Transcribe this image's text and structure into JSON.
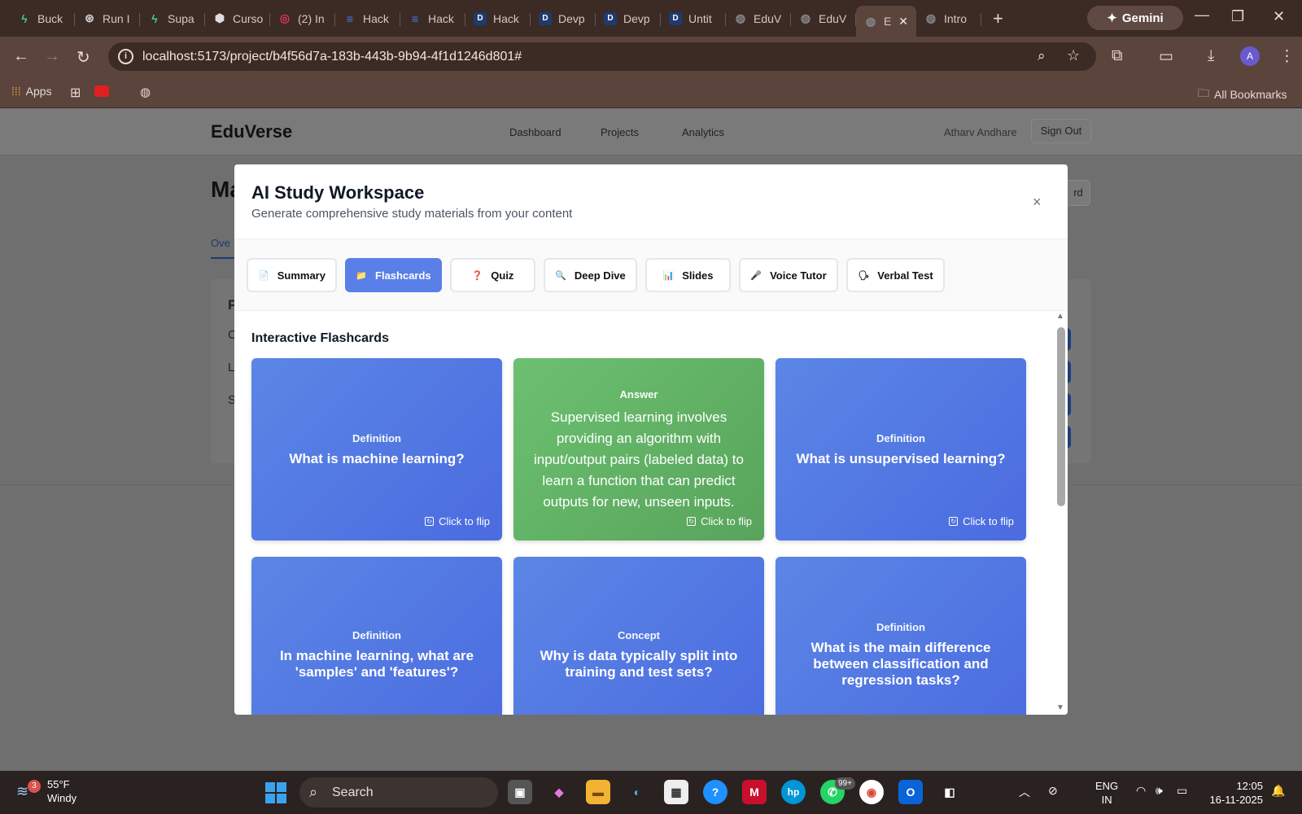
{
  "browser": {
    "tabs": [
      {
        "label": "Buck",
        "icon": "bolt",
        "color": "#3ecf8e"
      },
      {
        "label": "Run I",
        "icon": "openai",
        "color": "#cccccc"
      },
      {
        "label": "Supa",
        "icon": "bolt",
        "color": "#3ecf8e"
      },
      {
        "label": "Curso",
        "icon": "cube",
        "color": "#dddddd"
      },
      {
        "label": "(2) In",
        "icon": "instagram",
        "color": "#e1306c"
      },
      {
        "label": "Hack",
        "icon": "docs",
        "color": "#4a7df0"
      },
      {
        "label": "Hack",
        "icon": "docs",
        "color": "#4a7df0"
      },
      {
        "label": "Hack",
        "icon": "D",
        "color": "#1e3a6e"
      },
      {
        "label": "Devp",
        "icon": "D",
        "color": "#1e3a6e"
      },
      {
        "label": "Devp",
        "icon": "D",
        "color": "#1e3a6e"
      },
      {
        "label": "Untit",
        "icon": "D",
        "color": "#1e3a6e"
      },
      {
        "label": "EduV",
        "icon": "globe",
        "color": "#888888"
      },
      {
        "label": "EduV",
        "icon": "globe",
        "color": "#888888"
      },
      {
        "label": "E",
        "icon": "globe",
        "color": "#888888",
        "active": true
      },
      {
        "label": "Intro",
        "icon": "globe",
        "color": "#888888"
      }
    ],
    "new_tab": "+",
    "gemini_label": "Gemini",
    "url": "localhost:5173/project/b4f56d7a-183b-443b-9b94-4f1d1246d801#",
    "profile_initial": "A",
    "bookmarks": {
      "apps": "Apps",
      "all_bookmarks": "All Bookmarks"
    }
  },
  "app": {
    "brand": "EduVerse",
    "nav": [
      "Dashboard",
      "Projects",
      "Analytics"
    ],
    "user": "Atharv Andhare",
    "sign_out": "Sign Out",
    "bg_title": "Ma",
    "bg_right_button": "rd",
    "bg_tab": "Ove",
    "bg_card_heading": "P",
    "bg_lines": [
      "C",
      "L",
      "S"
    ]
  },
  "modal": {
    "title": "AI Study Workspace",
    "subtitle": "Generate comprehensive study materials from your content",
    "close": "×",
    "tools": [
      {
        "label": "Summary",
        "icon": "📄",
        "active": false
      },
      {
        "label": "Flashcards",
        "icon": "📁",
        "active": true
      },
      {
        "label": "Quiz",
        "icon": "❓",
        "active": false
      },
      {
        "label": "Deep Dive",
        "icon": "🔍",
        "active": false
      },
      {
        "label": "Slides",
        "icon": "📊",
        "active": false
      },
      {
        "label": "Voice Tutor",
        "icon": "🎤",
        "active": false
      },
      {
        "label": "Verbal Test",
        "icon": "🗣",
        "active": false
      }
    ],
    "section_title": "Interactive Flashcards",
    "flip_label": "Click to flip",
    "cards": [
      {
        "kind": "Definition",
        "text": "What is machine learning?",
        "face": "question"
      },
      {
        "kind": "Answer",
        "text": "Supervised learning involves providing an algorithm with input/output pairs (labeled data) to learn a function that can predict outputs for new, unseen inputs.",
        "face": "answer"
      },
      {
        "kind": "Definition",
        "text": "What is unsupervised learning?",
        "face": "question"
      },
      {
        "kind": "Definition",
        "text": "In machine learning, what are 'samples' and 'features'?",
        "face": "question"
      },
      {
        "kind": "Concept",
        "text": "Why is data typically split into training and test sets?",
        "face": "question"
      },
      {
        "kind": "Definition",
        "text": "What is the main difference between classification and regression tasks?",
        "face": "question"
      }
    ]
  },
  "taskbar": {
    "weather_badge": "3",
    "temp": "55°F",
    "condition": "Windy",
    "search": "Search",
    "whatsapp_badge": "99+",
    "lang_top": "ENG",
    "lang_bottom": "IN",
    "time": "12:05",
    "date": "16-11-2025"
  }
}
